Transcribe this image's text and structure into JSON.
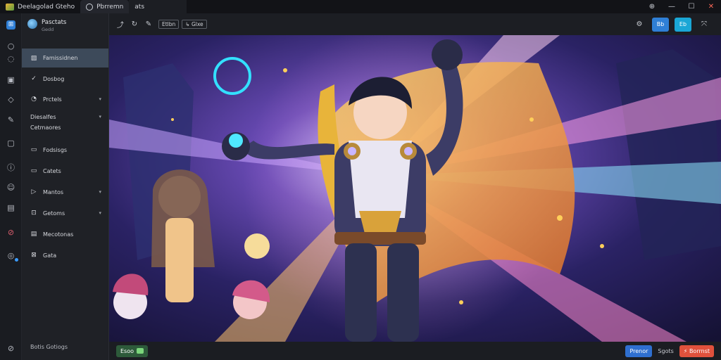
{
  "window": {
    "tabs": [
      {
        "label": "Deelagolad Gteho",
        "icon": "app-icon"
      },
      {
        "label": "Pbrremn",
        "icon": "ghost-icon"
      },
      {
        "label": "ats",
        "icon": ""
      }
    ],
    "controls": {
      "back": "⊕",
      "minimize": "—",
      "maximize": "☐",
      "close": "✕"
    }
  },
  "sidebar": {
    "header": {
      "title": "Pasctats",
      "subtitle": "Gedd"
    },
    "items": [
      {
        "label": "Famissidnen",
        "icon": "image-icon",
        "selected": true
      },
      {
        "label": "Dosbog",
        "icon": "check-icon"
      },
      {
        "label": "Prctels",
        "icon": "gauge-icon",
        "caret": "▾"
      },
      {
        "label": "Diesalfes",
        "icon": "",
        "caret": "▾"
      },
      {
        "label": "Cetmaores",
        "icon": ""
      },
      {
        "label": "Fodsisgs",
        "icon": "folder-icon"
      },
      {
        "label": "Catets",
        "icon": "folder-icon"
      },
      {
        "label": "Mantos",
        "icon": "terminal-icon",
        "caret": "▾"
      },
      {
        "label": "Getoms",
        "icon": "grid-icon",
        "caret": "▾"
      },
      {
        "label": "Mecotonas",
        "icon": "document-icon"
      },
      {
        "label": "Gata",
        "icon": "bookmark-icon"
      }
    ],
    "footer": "Botis Gotiogs"
  },
  "toolbar": {
    "btn1": "Etlbn",
    "btn2": "↳ Glxe",
    "right_btn1": "Bb",
    "right_btn2": "Eb"
  },
  "bottom": {
    "left_pill": "Esoo",
    "right_btn": "Prenor",
    "right_text": "Sgots",
    "right_red": "⚡ Borrnst"
  },
  "colors": {
    "accent_blue": "#2f7fd6",
    "cyan": "#1aa7d6",
    "red": "#e0513c",
    "green": "#3a6a3a"
  }
}
